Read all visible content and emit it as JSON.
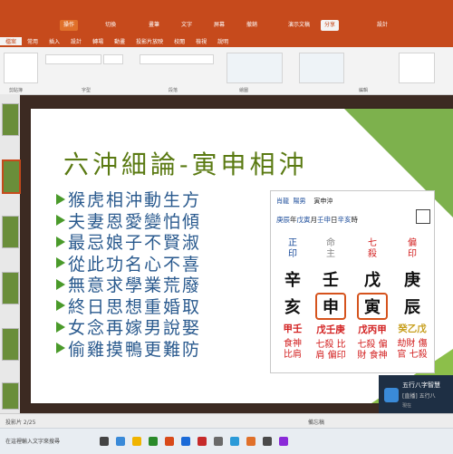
{
  "titlebar": {
    "buttons": [
      "操作",
      "切換",
      "畫筆",
      "文字",
      "屏幕",
      "撤銷"
    ],
    "filename": "演示文稿",
    "right_btn": "分享",
    "right_btn2": "設計"
  },
  "ribbon_tabs": [
    "檔案",
    "常用",
    "插入",
    "設計",
    "轉場",
    "動畫",
    "投影片放映",
    "校閱",
    "檢視",
    "說明"
  ],
  "ribbon_groups": [
    "剪貼簿",
    "投影片",
    "字型",
    "段落",
    "繪圖",
    "編輯"
  ],
  "slide": {
    "title": "六沖細論-寅申相沖",
    "bullets": [
      "猴虎相沖動生方",
      "夫妻恩愛變怕傾",
      "最忌娘子不賢淑",
      "從此功名心不喜",
      "無意求學業荒廢",
      "終日思想重婚取",
      "女念再嫁男說娶",
      "偷雞摸鴨更難防"
    ]
  },
  "bazi": {
    "label1": "肖龍",
    "label2": "陽男",
    "label3": "寅申沖",
    "date_row": [
      "庚辰",
      "年",
      "戊寅",
      "月",
      "壬申",
      "日",
      "辛亥",
      "時"
    ],
    "seal": "",
    "columns": [
      {
        "god": "正印",
        "stem": "辛",
        "branch": "亥",
        "hidden": "甲壬",
        "hidden_gods": "食神 比肩"
      },
      {
        "god": "命主",
        "stem": "壬",
        "branch": "申",
        "hidden": "戊壬庚",
        "hidden_gods": "七殺 比肩 偏印"
      },
      {
        "god": "七殺",
        "stem": "戊",
        "branch": "寅",
        "hidden": "戊丙甲",
        "hidden_gods": "七殺 偏財 食神"
      },
      {
        "god": "偏印",
        "stem": "庚",
        "branch": "辰",
        "hidden": "癸乙戊",
        "hidden_gods": "劫財 傷官 七殺"
      }
    ]
  },
  "status_bar": {
    "left": "投影片 2/25",
    "right": "備忘稿"
  },
  "toast": {
    "title": "五行八字智慧",
    "line": "[直播] 五行八",
    "sub": "現在"
  },
  "taskbar": {
    "search": "在這裡輸入文字來搜尋"
  }
}
